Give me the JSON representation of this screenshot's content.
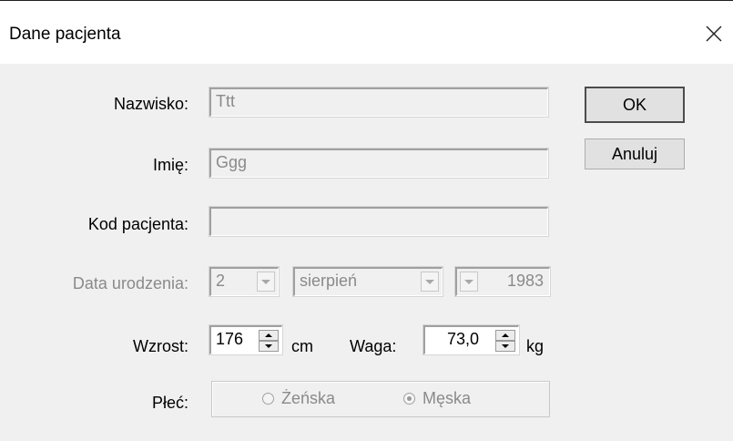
{
  "dialog": {
    "title": "Dane pacjenta",
    "close_icon": "close-icon"
  },
  "form": {
    "nazwisko": {
      "label": "Nazwisko:",
      "value": "Ttt"
    },
    "imie": {
      "label": "Imię:",
      "value": "Ggg"
    },
    "kod": {
      "label": "Kod pacjenta:",
      "value": ""
    },
    "data_urodzenia": {
      "label": "Data urodzenia:",
      "day": "2",
      "month": "sierpień",
      "year": "1983"
    },
    "wzrost": {
      "label": "Wzrost:",
      "value": "176",
      "unit": "cm"
    },
    "waga": {
      "label": "Waga:",
      "value": "73,0",
      "unit": "kg"
    },
    "plec": {
      "label": "Płeć:",
      "options": [
        "Żeńska",
        "Męska"
      ],
      "selected": "Męska"
    }
  },
  "buttons": {
    "ok": "OK",
    "cancel": "Anuluj"
  }
}
